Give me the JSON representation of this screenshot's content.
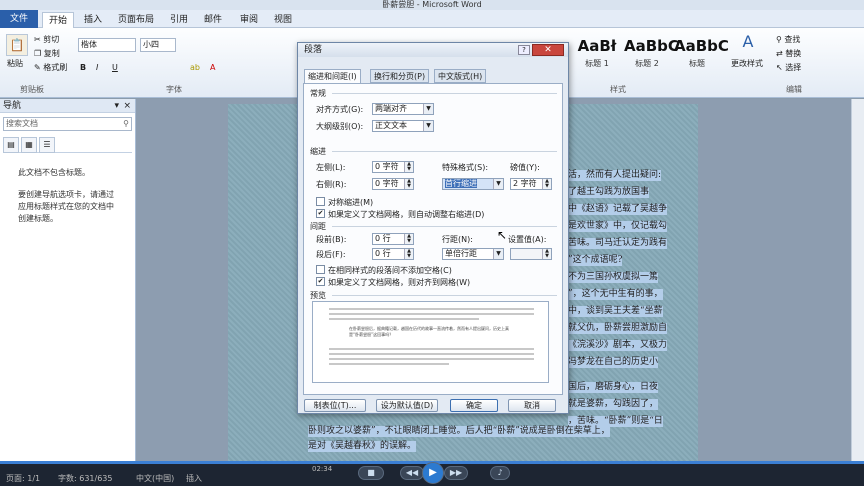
{
  "window": {
    "title": "卧薪尝胆 - Microsoft Word"
  },
  "ribbon_tabs": [
    "文件",
    "开始",
    "插入",
    "页面布局",
    "引用",
    "邮件",
    "审阅",
    "视图"
  ],
  "clipboard": {
    "paste": "粘贴",
    "cut": "剪切",
    "copy": "复制",
    "format_painter": "格式刷",
    "label": "剪贴板"
  },
  "font": {
    "name": "楷体",
    "size": "小四",
    "label": "字体"
  },
  "styles": {
    "items": [
      {
        "preview": "AaBł",
        "name": "标题 1"
      },
      {
        "preview": "AaBbC",
        "name": "标题 2"
      },
      {
        "preview": "AaBbC",
        "name": "标题"
      }
    ],
    "change": "更改样式",
    "label": "样式"
  },
  "editing": {
    "find": "查找",
    "replace": "替换",
    "select": "选择",
    "label": "编辑"
  },
  "nav": {
    "title": "导航",
    "search_placeholder": "搜索文档",
    "msg1": "此文档不包含标题。",
    "msg2": "要创建导航选项卡，请通过应用标题样式在您的文档中创建标题。"
  },
  "doc_lines": [
    "活，然而有人提出疑问:",
    "了越王勾践为放国事",
    "中《赵语》记载了吴越争",
    "是欢世家》中，仅记载勾",
    "苦味。司马迁认定为践有",
    "”这个成语呢?",
    "不为三国孙权虞拟一篤",
    "”，这个无中生有的事，",
    "中，谈到吴王夫差“坐薪",
    "就父仇，卧薪尝胆激励自",
    "《浣溪沙》剧本，又极力",
    "冯梦龙在自己的历史小",
    "国后，磨砺身心，日夜",
    "就是婆薪，勾践因了，",
    "，苦味。“卧薪”则是“日",
    "卧则攻之以婆薪”，不让眼睛闭上睡觉。后人把“卧薪”说成是卧倒在柴草上，",
    "是对《吴越春秋》的误解。"
  ],
  "dialog": {
    "title": "段落",
    "tabs": [
      "缩进和间距(I)",
      "换行和分页(P)",
      "中文版式(H)"
    ],
    "general": {
      "section": "常规",
      "align_label": "对齐方式(G):",
      "align_value": "两端对齐",
      "outline_label": "大纲级别(O):",
      "outline_value": "正文文本"
    },
    "indent": {
      "section": "缩进",
      "left_label": "左侧(L):",
      "left_value": "0 字符",
      "right_label": "右侧(R):",
      "right_value": "0 字符",
      "special_label": "特殊格式(S):",
      "special_value": "首行缩进",
      "by_label": "磅值(Y):",
      "by_value": "2 字符",
      "mirror": "对称缩进(M)",
      "auto_grid": "如果定义了文档网格，则自动调整右缩进(D)"
    },
    "spacing": {
      "section": "间距",
      "before_label": "段前(B):",
      "before_value": "0 行",
      "after_label": "段后(F):",
      "after_value": "0 行",
      "line_label": "行距(N):",
      "line_value": "单倍行距",
      "at_label": "设置值(A):",
      "at_value": "",
      "no_space": "在相同样式的段落间不添加空格(C)",
      "snap_grid": "如果定义了文档网格，则对齐到网格(W)"
    },
    "preview": {
      "section": "预览",
      "sample": "在卧薪尝胆后，据典籍记载，越国在历代的故事一直流传着，然而有人提出疑问，历史上真是“卧薪尝胆”这回事吗？"
    },
    "buttons": {
      "tabs": "制表位(T)...",
      "default": "设为默认值(D)",
      "ok": "确定",
      "cancel": "取消"
    }
  },
  "status": {
    "page": "页面: 1/1",
    "words": "字数: 631/635",
    "lang": "中文(中国)",
    "mode": "插入",
    "time": "02:34"
  }
}
